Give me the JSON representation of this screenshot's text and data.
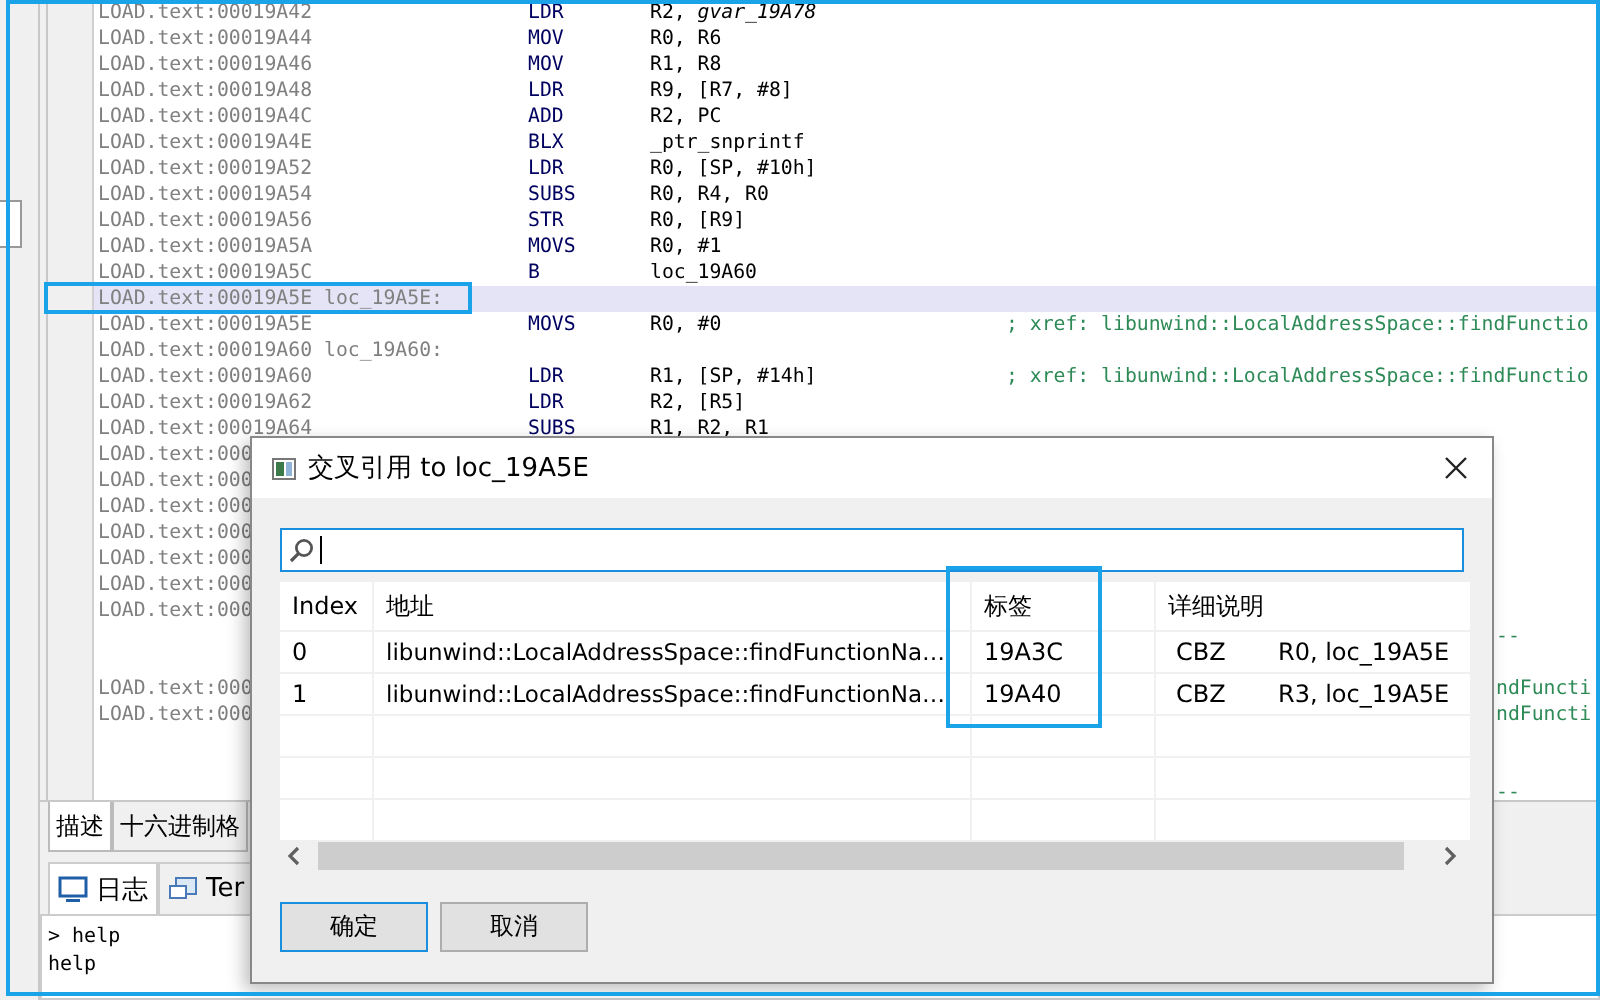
{
  "code_lines": [
    {
      "address": "LOAD.text:00019A42",
      "mnemonic": "LDR",
      "operands": "R2, *gvar_19A78*",
      "selected": false
    },
    {
      "address": "LOAD.text:00019A44",
      "mnemonic": "MOV",
      "operands": "R0, R6",
      "selected": false
    },
    {
      "address": "LOAD.text:00019A46",
      "mnemonic": "MOV",
      "operands": "R1, R8",
      "selected": false
    },
    {
      "address": "LOAD.text:00019A48",
      "mnemonic": "LDR",
      "operands": "R9, [R7, #8]",
      "selected": false
    },
    {
      "address": "LOAD.text:00019A4C",
      "mnemonic": "ADD",
      "operands": "R2, PC",
      "selected": false
    },
    {
      "address": "LOAD.text:00019A4E",
      "mnemonic": "BLX",
      "operands": "_ptr_snprintf",
      "selected": false
    },
    {
      "address": "LOAD.text:00019A52",
      "mnemonic": "LDR",
      "operands": "R0, [SP, #10h]",
      "selected": false
    },
    {
      "address": "LOAD.text:00019A54",
      "mnemonic": "SUBS",
      "operands": "R0, R4, R0",
      "selected": false
    },
    {
      "address": "LOAD.text:00019A56",
      "mnemonic": "STR",
      "operands": "R0, [R9]",
      "selected": false
    },
    {
      "address": "LOAD.text:00019A5A",
      "mnemonic": "MOVS",
      "operands": "R0, #1",
      "selected": false
    },
    {
      "address": "LOAD.text:00019A5C",
      "mnemonic": "B",
      "operands": "loc_19A60",
      "selected": false
    },
    {
      "address": "LOAD.text:00019A5E",
      "label": "loc_19A5E:",
      "selected": true
    },
    {
      "address": "LOAD.text:00019A5E",
      "mnemonic": "MOVS",
      "operands": "R0, #0",
      "comment": "; xref: libunwind::LocalAddressSpace::findFunctio",
      "selected": false
    },
    {
      "address": "LOAD.text:00019A60",
      "label": "loc_19A60:",
      "selected": false
    },
    {
      "address": "LOAD.text:00019A60",
      "mnemonic": "LDR",
      "operands": "R1, [SP, #14h]",
      "comment": "; xref: libunwind::LocalAddressSpace::findFunctio",
      "selected": false
    },
    {
      "address": "LOAD.text:00019A62",
      "mnemonic": "LDR",
      "operands": "R2, [R5]",
      "selected": false
    },
    {
      "address": "LOAD.text:00019A64",
      "mnemonic": "SUBS",
      "operands": "R1, R2, R1",
      "selected": false
    },
    {
      "address": "LOAD.text:000",
      "selected": false
    },
    {
      "address": "LOAD.text:000",
      "selected": false
    },
    {
      "address": "LOAD.text:000",
      "selected": false
    },
    {
      "address": "LOAD.text:000",
      "selected": false
    },
    {
      "address": "LOAD.text:000",
      "selected": false
    },
    {
      "address": "LOAD.text:000",
      "selected": false
    },
    {
      "address": "LOAD.text:000",
      "selected": false
    },
    {
      "tail": "--",
      "selected": false
    },
    {
      "selected": false
    },
    {
      "address": "LOAD.text:000",
      "tail": "ndFuncti",
      "selected": false
    },
    {
      "address": "LOAD.text:000",
      "tail": "ndFuncti",
      "selected": false
    },
    {
      "selected": false
    },
    {
      "selected": false
    },
    {
      "tail": "--",
      "selected": false
    }
  ],
  "code_tabs": [
    {
      "label": "描述",
      "selected": true
    },
    {
      "label": "十六进制格",
      "selected": false
    }
  ],
  "log_tabs": [
    {
      "label": "日志",
      "selected": true
    },
    {
      "label": "Ter",
      "selected": false
    }
  ],
  "console_lines": [
    "> help",
    "help"
  ],
  "dialog": {
    "title": "交叉引用 to loc_19A5E",
    "columns": [
      "Index",
      "地址",
      "标签",
      "详细说明"
    ],
    "rows": [
      {
        "index": "0",
        "address": "libunwind::LocalAddressSpace::findFunctionNa…",
        "tag": "19A3C",
        "detail_mnemonic": "CBZ",
        "detail_operands": "R0, loc_19A5E"
      },
      {
        "index": "1",
        "address": "libunwind::LocalAddressSpace::findFunctionNa…",
        "tag": "19A40",
        "detail_mnemonic": "CBZ",
        "detail_operands": "R3, loc_19A5E"
      }
    ],
    "buttons": [
      {
        "label": "确定",
        "default": true
      },
      {
        "label": "取消",
        "default": false
      }
    ]
  }
}
